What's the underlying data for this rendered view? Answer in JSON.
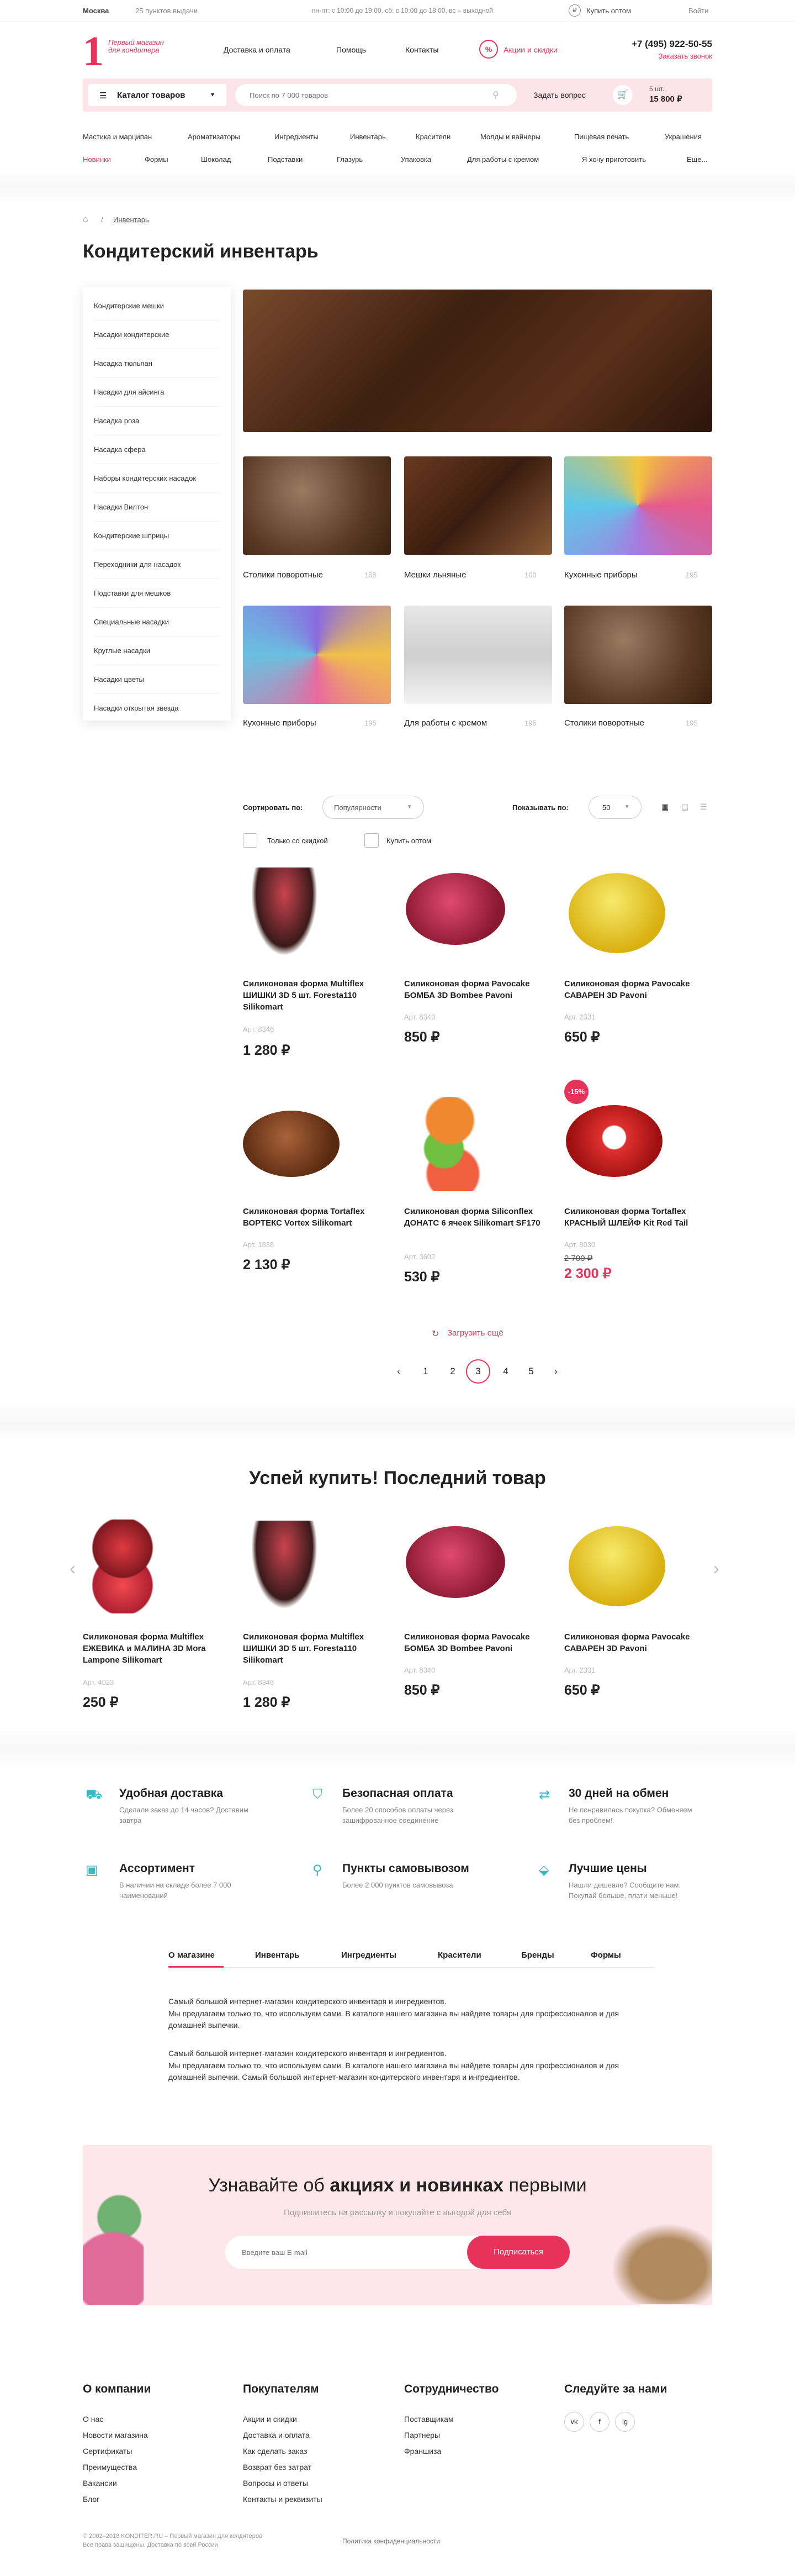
{
  "topbar": {
    "city": "Москва",
    "pickup": "25 пунктов выдачи",
    "hours": "пн-пт: с 10:00 до 19:00, сб: с 10:00 до 18:00, вс – выходной",
    "wholesale": "Купить оптом",
    "login": "Войти"
  },
  "logo": {
    "num": "1",
    "text": "Первый магазин для кондитера"
  },
  "nav": [
    "Доставка и оплата",
    "Помощь",
    "Контакты"
  ],
  "promo": "Акции и скидки",
  "phone": "+7 (495) 922-50-55",
  "callback": "Заказать звонок",
  "catalog_label": "Каталог товаров",
  "search": {
    "placeholder": "Поиск по 7 000 товаров",
    "ask": "Задать вопрос"
  },
  "cart": {
    "count": "5 шт.",
    "total": "15 800 ₽"
  },
  "cats1": [
    "Мастика и марципан",
    "Ароматизаторы",
    "Ингредиенты",
    "Инвентарь",
    "Красители",
    "Молды и вайнеры",
    "Пищевая печать",
    "Украшения"
  ],
  "cats2": [
    "Новинки",
    "Формы",
    "Шоколад",
    "Подставки",
    "Глазурь",
    "Упаковка",
    "Для работы с кремом",
    "Я хочу приготовить",
    "Еще..."
  ],
  "breadcrumb": "Инвентарь",
  "title": "Кондитерский инвентарь",
  "side": [
    "Кондитерские мешки",
    "Насадки кондитерские",
    "Насадка тюльпан",
    "Насадки для айсинга",
    "Насадка роза",
    "Насадка сфера",
    "Наборы кондитерских насадок",
    "Насадки Вилтон",
    "Кондитерские шприцы",
    "Переходники для насадок",
    "Подставки для мешков",
    "Специальные насадки",
    "Круглые насадки",
    "Насадки цветы",
    "Насадки открытая звезда"
  ],
  "tiles": [
    {
      "label": "Столики поворотные",
      "count": "158"
    },
    {
      "label": "Мешки льняные",
      "count": "100"
    },
    {
      "label": "Кухонные приборы",
      "count": "195"
    },
    {
      "label": "Кухонные приборы",
      "count": "195"
    },
    {
      "label": "Для работы с кремом",
      "count": "195"
    },
    {
      "label": "Столики поворотные",
      "count": "195"
    }
  ],
  "sort": {
    "label": "Сортировать по:",
    "value": "Популярности",
    "show": "Показывать по:",
    "show_value": "50",
    "discount": "Только со скидкой",
    "wholesale": "Купить оптом"
  },
  "products": [
    {
      "name": "Силиконовая форма Multiflex ШИШКИ 3D 5 шт. Foresta110 Silikomart",
      "art": "Арт. 8346",
      "price": "1 280 ₽"
    },
    {
      "name": "Силиконовая форма Pavocake БОМБА 3D Bombee Pavoni",
      "art": "Арт. 8340",
      "price": "850 ₽"
    },
    {
      "name": "Силиконовая форма Pavocake САВАРЕН 3D Pavoni",
      "art": "Арт. 2331",
      "price": "650 ₽"
    },
    {
      "name": "Силиконовая форма Tortaflex ВОРТЕКС Vortex Silikomart",
      "art": "Арт. 1838",
      "price": "2 130 ₽"
    },
    {
      "name": "Силиконовая форма Siliconflex ДОНАТС 6 ячеек Silikomart SF170",
      "art": "Арт. 3602",
      "price": "530 ₽"
    },
    {
      "name": "Силиконовая форма Tortaflex КРАСНЫЙ ШЛЕЙФ Kit Red Tail",
      "art": "Арт. 8030",
      "price": "2 300 ₽",
      "old": "2 700 ₽",
      "badge": "-15%"
    }
  ],
  "load_more": "Загрузить ещё",
  "pages": [
    "1",
    "2",
    "3",
    "4",
    "5"
  ],
  "last": {
    "title": "Успей купить! Последний товар",
    "items": [
      {
        "name": "Силиконовая форма Multiflex ЕЖЕВИКА и МАЛИНА 3D Mora Lampone Silikomart",
        "art": "Арт. 4023",
        "price": "250 ₽"
      },
      {
        "name": "Силиконовая форма Multiflex ШИШКИ 3D 5 шт. Foresta110 Silikomart",
        "art": "Арт. 8346",
        "price": "1 280 ₽"
      },
      {
        "name": "Силиконовая форма Pavocake БОМБА 3D Bombee Pavoni",
        "art": "Арт. 8340",
        "price": "850 ₽"
      },
      {
        "name": "Силиконовая форма Pavocake САВАРЕН 3D Pavoni",
        "art": "Арт. 2331",
        "price": "650 ₽"
      }
    ]
  },
  "features": [
    {
      "title": "Удобная доставка",
      "sub": "Сделали заказ до 14 часов? Доставим завтра"
    },
    {
      "title": "Безопасная оплата",
      "sub": "Более 20 способов оплаты через зашифрованное соединение"
    },
    {
      "title": "30 дней на обмен",
      "sub": "Не понравилась покупка? Обменяем без проблем!"
    },
    {
      "title": "Ассортимент",
      "sub": "В наличии на складе более 7 000 наименований"
    },
    {
      "title": "Пункты самовывозом",
      "sub": "Более 2 000 пунктов самовывоза"
    },
    {
      "title": "Лучшие цены",
      "sub": "Нашли дешевле? Сообщите нам. Покупай больше, плати меньше!"
    }
  ],
  "tabs": [
    "О магазине",
    "Инвентарь",
    "Ингредиенты",
    "Красители",
    "Бренды",
    "Формы"
  ],
  "about": [
    "Самый большой интернет-магазин кондитерского инвентаря и ингредиентов.",
    "Мы предлагаем только то, что используем сами. В каталоге нашего магазина вы найдете товары для профессионалов и для домашней выпечки.",
    "Самый большой интернет-магазин кондитерского инвентаря и ингредиентов.",
    "Мы предлагаем только то, что используем сами. В каталоге нашего магазина вы найдете товары для профессионалов и для домашней выпечки. Самый большой интернет-магазин кондитерского инвентаря и ингредиентов."
  ],
  "subscribe": {
    "pre": "Узнавайте об ",
    "bold": "акциях и новинках",
    "post": " первыми",
    "sub": "Подпишитесь на рассылку и покупайте с выгодой для себя",
    "placeholder": "Введите ваш E-mail",
    "button": "Подписаться"
  },
  "footer": {
    "cols": [
      {
        "title": "О компании",
        "links": [
          "О нас",
          "Новости магазина",
          "Сертификаты",
          "Преимущества",
          "Вакансии",
          "Блог"
        ]
      },
      {
        "title": "Покупателям",
        "links": [
          "Акции и скидки",
          "Доставка и оплата",
          "Как сделать заказ",
          "Возврат без затрат",
          "Вопросы и ответы",
          "Контакты и реквизиты"
        ]
      },
      {
        "title": "Сотрудничество",
        "links": [
          "Поставщикам",
          "Партнеры",
          "Франшиза"
        ]
      },
      {
        "title": "Следуйте за нами",
        "links": []
      }
    ],
    "social": [
      "vk",
      "f",
      "ig"
    ],
    "copy1": "© 2002–2018 KONDITER.RU – Первый магазин для кондитеров",
    "copy2": "Все права защищены. Доставка по всей России",
    "policy": "Политика конфиденциальности"
  }
}
